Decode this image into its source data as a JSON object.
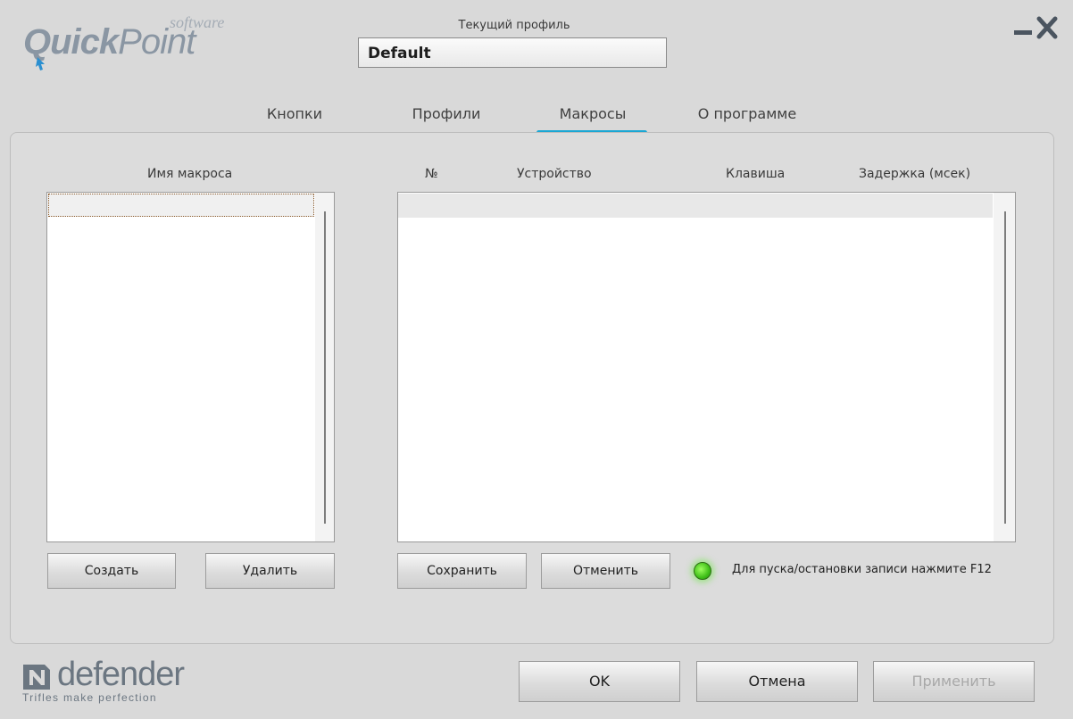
{
  "logo": {
    "brand_a": "Quick",
    "brand_b": "Point",
    "software": "software"
  },
  "profile": {
    "label": "Текущий профиль",
    "value": "Default"
  },
  "tabs": [
    {
      "label": "Кнопки"
    },
    {
      "label": "Профили"
    },
    {
      "label": "Макросы",
      "active": true
    },
    {
      "label": "О программе"
    }
  ],
  "macros": {
    "name_header": "Имя макроса",
    "columns": [
      "№",
      "Устройство",
      "Клавиша",
      "Задержка (мсек)"
    ],
    "create_label": "Создать",
    "delete_label": "Удалить",
    "save_label": "Сохранить",
    "cancel_label": "Отменить",
    "hint": "Для пуска/остановки записи нажмите F12"
  },
  "footer": {
    "brand": "defender",
    "tagline": "Trifles make perfection",
    "ok_label": "OK",
    "cancel_label": "Отмена",
    "apply_label": "Применить"
  },
  "colors": {
    "accent": "#1aa7d4",
    "led": "#3fbf18"
  },
  "icons": {
    "minimize": "minimize-icon",
    "close": "close-icon",
    "record_indicator": "led-indicator-icon"
  }
}
